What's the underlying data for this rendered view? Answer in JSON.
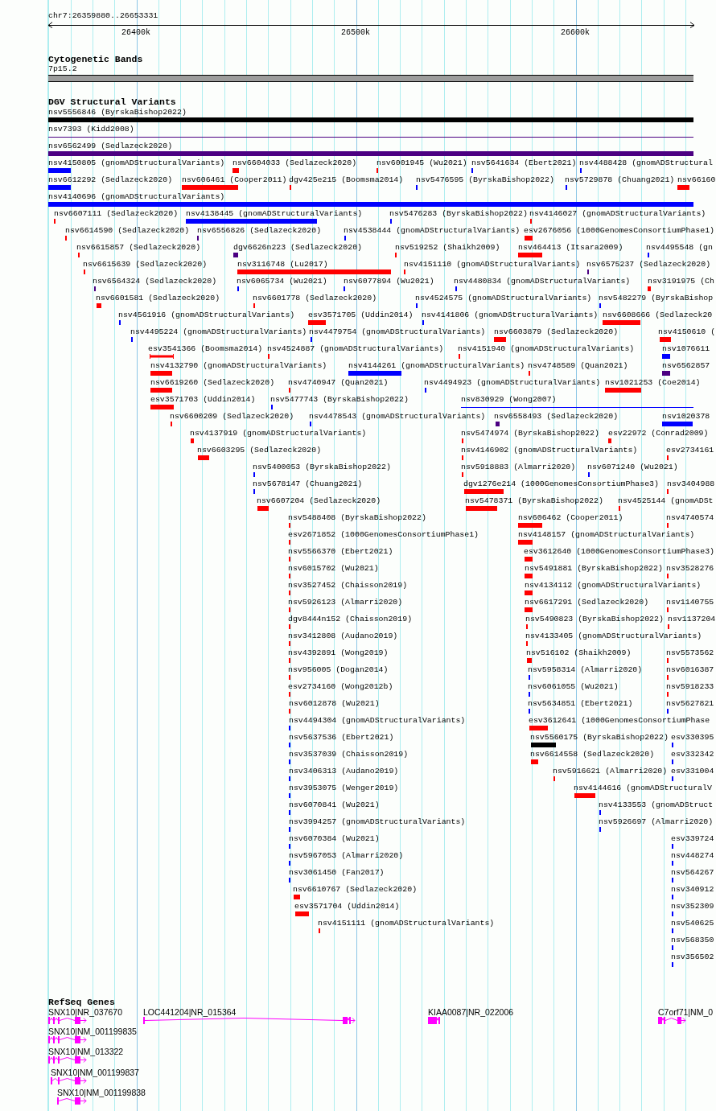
{
  "ruler": {
    "location": "chr7:26359880..26653331",
    "ticks": [
      "26400k",
      "26500k",
      "26600k"
    ]
  },
  "tracks": [
    {
      "title": "Cytogenetic Bands",
      "kind": "bands",
      "features": [
        {
          "label": "7p15.2"
        }
      ]
    },
    {
      "title": "DGV Structural Variants",
      "kind": "variants",
      "rows": [
        {
          "features": [
            {
              "label": "nsv5556846 (ByrskaBishop2022)",
              "color": "#000000",
              "kind": "bar"
            }
          ]
        },
        {
          "features": [
            {
              "label": "nsv7393 (Kidd2008)",
              "color": "#4b0082",
              "kind": "line"
            }
          ]
        },
        {
          "features": [
            {
              "label": "nsv6562499 (Sedlazeck2020)",
              "color": "#4b0082",
              "kind": "bar"
            }
          ]
        },
        {
          "features": [
            {
              "label": "nsv4150805 (gnomADStructuralVariants)",
              "color": "#0000ff",
              "kind": "bar"
            },
            {
              "label": "nsv6604033 (Sedlazeck2020)",
              "color": "#ff0000",
              "kind": "bar"
            },
            {
              "label": "nsv6001945 (Wu2021)",
              "color": "#ff0000",
              "kind": "bar"
            },
            {
              "label": "nsv5641634 (Ebert2021)",
              "color": "#0000ff",
              "kind": "bar"
            },
            {
              "label": "nsv4488428 (gnomADStructural",
              "color": "#0000ff",
              "kind": "bar"
            }
          ]
        },
        {
          "features": [
            {
              "label": "nsv6612292 (Sedlazeck2020)",
              "color": "#0000ff",
              "kind": "bar"
            },
            {
              "label": "nsv606461 (Cooper2011)",
              "color": "#ff0000",
              "kind": "bar"
            },
            {
              "label": "dgv425e215 (Boomsma2014)",
              "color": "#ff0000",
              "kind": "bar"
            },
            {
              "label": "nsv5476595 (ByrskaBishop2022)",
              "color": "#0000ff",
              "kind": "bar"
            },
            {
              "label": "nsv5729878 (Chuang2021)",
              "color": "#0000ff",
              "kind": "bar"
            },
            {
              "label": "nsv66160",
              "color": "#ff0000",
              "kind": "bar"
            }
          ]
        },
        {
          "features": [
            {
              "label": "nsv4140696 (gnomADStructuralVariants)",
              "color": "#0000ff",
              "kind": "bar"
            }
          ]
        },
        {
          "features": [
            {
              "label": "nsv6607111 (Sedlazeck2020)",
              "color": "#ff0000",
              "kind": "bar"
            },
            {
              "label": "nsv4138445 (gnomADStructuralVariants)",
              "color": "#0000ff",
              "kind": "bar"
            },
            {
              "label": "nsv5476283 (ByrskaBishop2022)",
              "color": "#0000ff",
              "kind": "bar"
            },
            {
              "label": "nsv4146027 (gnomADStructuralVariants)",
              "color": "#ff0000",
              "kind": "bar"
            }
          ]
        },
        {
          "features": [
            {
              "label": "nsv6614590 (Sedlazeck2020)",
              "color": "#ff0000",
              "kind": "bar"
            },
            {
              "label": "nsv6556826 (Sedlazeck2020)",
              "color": "#4b0082",
              "kind": "bar"
            },
            {
              "label": "nsv4538444 (gnomADStructuralVariants)",
              "color": "#0000ff",
              "kind": "bar"
            },
            {
              "label": "esv2676056 (1000GenomesConsortiumPhase1)",
              "color": "#ff0000",
              "kind": "bar"
            }
          ]
        },
        {
          "features": [
            {
              "label": "nsv6615857 (Sedlazeck2020)",
              "color": "#ff0000",
              "kind": "bar"
            },
            {
              "label": "dgv6626n223 (Sedlazeck2020)",
              "color": "#4b0082",
              "kind": "bar"
            },
            {
              "label": "nsv519252 (Shaikh2009)",
              "color": "#ff0000",
              "kind": "bar"
            },
            {
              "label": "nsv464413 (Itsara2009)",
              "color": "#ff0000",
              "kind": "bar"
            },
            {
              "label": "nsv4495548 (gn",
              "color": "#0000ff",
              "kind": "bar"
            }
          ]
        },
        {
          "features": [
            {
              "label": "nsv6615639 (Sedlazeck2020)",
              "color": "#ff0000",
              "kind": "bar"
            },
            {
              "label": "nsv3116748 (Lu2017)",
              "color": "#ff0000",
              "kind": "bar"
            },
            {
              "label": "nsv4151110 (gnomADStructuralVariants)",
              "color": "#ff0000",
              "kind": "bar"
            },
            {
              "label": "nsv6575237 (Sedlazeck2020)",
              "color": "#4b0082",
              "kind": "bar"
            }
          ]
        },
        {
          "features": [
            {
              "label": "nsv6564324 (Sedlazeck2020)",
              "color": "#4b0082",
              "kind": "bar"
            },
            {
              "label": "nsv6065734 (Wu2021)",
              "color": "#0000ff",
              "kind": "bar"
            },
            {
              "label": "nsv6077894 (Wu2021)",
              "color": "#0000ff",
              "kind": "bar"
            },
            {
              "label": "nsv4480834 (gnomADStructuralVariants)",
              "color": "#0000ff",
              "kind": "bar"
            },
            {
              "label": "nsv3191975 (Ch",
              "color": "#ff0000",
              "kind": "bar"
            }
          ]
        },
        {
          "features": [
            {
              "label": "nsv6601581 (Sedlazeck2020)",
              "color": "#ff0000",
              "kind": "bar"
            },
            {
              "label": "nsv6601778 (Sedlazeck2020)",
              "color": "#ff0000",
              "kind": "bar"
            },
            {
              "label": "nsv4524575 (gnomADStructuralVariants)",
              "color": "#0000ff",
              "kind": "bar"
            },
            {
              "label": "nsv5482279 (ByrskaBishop",
              "color": "#0000ff",
              "kind": "bar"
            }
          ]
        },
        {
          "features": [
            {
              "label": "nsv4561916 (gnomADStructuralVariants)",
              "color": "#0000ff",
              "kind": "bar"
            },
            {
              "label": "esv3571705 (Uddin2014)",
              "color": "#ff0000",
              "kind": "bar"
            },
            {
              "label": "nsv4141806 (gnomADStructuralVariants)",
              "color": "#0000ff",
              "kind": "bar"
            },
            {
              "label": "nsv6608666 (Sedlazeck20",
              "color": "#ff0000",
              "kind": "bar"
            }
          ]
        },
        {
          "features": [
            {
              "label": "nsv4495224 (gnomADStructuralVariants)",
              "color": "#0000ff",
              "kind": "bar"
            },
            {
              "label": "nsv4479754 (gnomADStructuralVariants)",
              "color": "#0000ff",
              "kind": "bar"
            },
            {
              "label": "nsv6603879 (Sedlazeck2020)",
              "color": "#ff0000",
              "kind": "bar"
            },
            {
              "label": "nsv4150610 (",
              "color": "#ff0000",
              "kind": "bar"
            }
          ]
        },
        {
          "features": [
            {
              "label": "esv3541366 (Boomsma2014)",
              "color": "#ff0000",
              "kind": "capped"
            },
            {
              "label": "nsv4524887 (gnomADStructuralVariants)",
              "color": "#ff0000",
              "kind": "bar"
            },
            {
              "label": "nsv4151940 (gnomADStructuralVariants)",
              "color": "#ff0000",
              "kind": "bar"
            },
            {
              "label": "nsv1076611",
              "color": "#0000ff",
              "kind": "bar"
            }
          ]
        },
        {
          "features": [
            {
              "label": "nsv4132790 (gnomADStructuralVariants)",
              "color": "#ff0000",
              "kind": "bar"
            },
            {
              "label": "nsv4144261 (gnomADStructuralVariants)",
              "color": "#0000ff",
              "kind": "bar"
            },
            {
              "label": "nsv4748589 (Quan2021)",
              "color": "#ff0000",
              "kind": "bar"
            },
            {
              "label": "nsv6562857",
              "color": "#4b0082",
              "kind": "bar"
            }
          ]
        },
        {
          "features": [
            {
              "label": "nsv6619260 (Sedlazeck2020)",
              "color": "#ff0000",
              "kind": "bar"
            },
            {
              "label": "nsv4740947 (Quan2021)",
              "color": "#ff0000",
              "kind": "bar"
            },
            {
              "label": "nsv4494923 (gnomADStructuralVariants)",
              "color": "#0000ff",
              "kind": "bar"
            },
            {
              "label": "nsv1021253 (Coe2014)",
              "color": "#ff0000",
              "kind": "bar"
            }
          ]
        },
        {
          "features": [
            {
              "label": "esv3571703 (Uddin2014)",
              "color": "#ff0000",
              "kind": "bar"
            },
            {
              "label": "nsv5477743 (ByrskaBishop2022)",
              "color": "#0000ff",
              "kind": "bar"
            },
            {
              "label": "nsv830929 (Wong2007)",
              "color": "#0000ff",
              "kind": "line"
            }
          ]
        },
        {
          "features": [
            {
              "label": "nsv6600209 (Sedlazeck2020)",
              "color": "#ff0000",
              "kind": "bar"
            },
            {
              "label": "nsv4478543 (gnomADStructuralVariants)",
              "color": "#0000ff",
              "kind": "bar"
            },
            {
              "label": "nsv6558493 (Sedlazeck2020)",
              "color": "#4b0082",
              "kind": "bar"
            },
            {
              "label": "nsv1020378",
              "color": "#0000ff",
              "kind": "bar"
            }
          ]
        },
        {
          "features": [
            {
              "label": "nsv4137919 (gnomADStructuralVariants)",
              "color": "#ff0000",
              "kind": "bar"
            },
            {
              "label": "nsv5474974 (ByrskaBishop2022)",
              "color": "#ff0000",
              "kind": "bar"
            },
            {
              "label": "esv22972 (Conrad2009)",
              "color": "#ff0000",
              "kind": "bar"
            }
          ]
        },
        {
          "features": [
            {
              "label": "nsv6603295 (Sedlazeck2020)",
              "color": "#ff0000",
              "kind": "bar"
            },
            {
              "label": "nsv4146902 (gnomADStructuralVariants)",
              "color": "#ff0000",
              "kind": "bar"
            },
            {
              "label": "esv2734161",
              "color": "#ff0000",
              "kind": "bar"
            }
          ]
        },
        {
          "features": [
            {
              "label": "nsv5400053 (ByrskaBishop2022)",
              "color": "#0000ff",
              "kind": "bar"
            },
            {
              "label": "nsv5918883 (Almarri2020)",
              "color": "#ff0000",
              "kind": "bar"
            },
            {
              "label": "nsv6071240 (Wu2021)",
              "color": "#0000ff",
              "kind": "bar"
            }
          ]
        },
        {
          "features": [
            {
              "label": "nsv5678147 (Chuang2021)",
              "color": "#0000ff",
              "kind": "bar"
            },
            {
              "label": "dgv1276e214 (1000GenomesConsortiumPhase3)",
              "color": "#ff0000",
              "kind": "bar"
            },
            {
              "label": "nsv3404988",
              "color": "#ff0000",
              "kind": "bar"
            }
          ]
        },
        {
          "features": [
            {
              "label": "nsv6607204 (Sedlazeck2020)",
              "color": "#ff0000",
              "kind": "bar"
            },
            {
              "label": "nsv5478371 (ByrskaBishop2022)",
              "color": "#ff0000",
              "kind": "bar"
            },
            {
              "label": "nsv4525144 (gnomADSt",
              "color": "#ff0000",
              "kind": "bar"
            }
          ]
        },
        {
          "features": [
            {
              "label": "nsv5488408 (ByrskaBishop2022)",
              "color": "#ff0000",
              "kind": "bar"
            },
            {
              "label": "nsv606462 (Cooper2011)",
              "color": "#ff0000",
              "kind": "bar"
            },
            {
              "label": "nsv4740574",
              "color": "#ff0000",
              "kind": "bar"
            }
          ]
        },
        {
          "features": [
            {
              "label": "esv2671852 (1000GenomesConsortiumPhase1)",
              "color": "#ff0000",
              "kind": "bar"
            },
            {
              "label": "nsv4148157 (gnomADStructuralVariants)",
              "color": "#ff0000",
              "kind": "bar"
            }
          ]
        },
        {
          "features": [
            {
              "label": "nsv5566370 (Ebert2021)",
              "color": "#ff0000",
              "kind": "bar"
            },
            {
              "label": "esv3612640 (1000GenomesConsortiumPhase3)",
              "color": "#ff0000",
              "kind": "bar"
            }
          ]
        },
        {
          "features": [
            {
              "label": "nsv6015702 (Wu2021)",
              "color": "#ff0000",
              "kind": "bar"
            },
            {
              "label": "nsv5491881 (ByrskaBishop2022)",
              "color": "#ff0000",
              "kind": "bar"
            },
            {
              "label": "nsv3528276",
              "color": "#ff0000",
              "kind": "bar"
            }
          ]
        },
        {
          "features": [
            {
              "label": "nsv3527452 (Chaisson2019)",
              "color": "#ff0000",
              "kind": "bar"
            },
            {
              "label": "nsv4134112 (gnomADStructuralVariants)",
              "color": "#ff0000",
              "kind": "bar"
            }
          ]
        },
        {
          "features": [
            {
              "label": "nsv5926123 (Almarri2020)",
              "color": "#ff0000",
              "kind": "bar"
            },
            {
              "label": "nsv6617291 (Sedlazeck2020)",
              "color": "#ff0000",
              "kind": "bar"
            },
            {
              "label": "nsv1140755",
              "color": "#ff0000",
              "kind": "bar"
            }
          ]
        },
        {
          "features": [
            {
              "label": "dgv8444n152 (Chaisson2019)",
              "color": "#ff0000",
              "kind": "bar"
            },
            {
              "label": "nsv5490823 (ByrskaBishop2022)",
              "color": "#ff0000",
              "kind": "bar"
            },
            {
              "label": "nsv1137204",
              "color": "#ff0000",
              "kind": "bar"
            }
          ]
        },
        {
          "features": [
            {
              "label": "nsv3412808 (Audano2019)",
              "color": "#ff0000",
              "kind": "bar"
            },
            {
              "label": "nsv4133405 (gnomADStructuralVariants)",
              "color": "#ff0000",
              "kind": "bar"
            }
          ]
        },
        {
          "features": [
            {
              "label": "nsv4392891 (Wong2019)",
              "color": "#ff0000",
              "kind": "bar"
            },
            {
              "label": "nsv516102 (Shaikh2009)",
              "color": "#ff0000",
              "kind": "bar"
            },
            {
              "label": "nsv5573562",
              "color": "#ff0000",
              "kind": "bar"
            }
          ]
        },
        {
          "features": [
            {
              "label": "nsv956005 (Dogan2014)",
              "color": "#ff0000",
              "kind": "bar"
            },
            {
              "label": "nsv5958314 (Almarri2020)",
              "color": "#0000ff",
              "kind": "bar"
            },
            {
              "label": "nsv6016387",
              "color": "#ff0000",
              "kind": "bar"
            }
          ]
        },
        {
          "features": [
            {
              "label": "esv2734160 (Wong2012b)",
              "color": "#ff0000",
              "kind": "bar"
            },
            {
              "label": "nsv6061055 (Wu2021)",
              "color": "#0000ff",
              "kind": "bar"
            },
            {
              "label": "nsv5918233",
              "color": "#ff0000",
              "kind": "bar"
            }
          ]
        },
        {
          "features": [
            {
              "label": "nsv6012878 (Wu2021)",
              "color": "#ff0000",
              "kind": "bar"
            },
            {
              "label": "nsv5634851 (Ebert2021)",
              "color": "#0000ff",
              "kind": "bar"
            },
            {
              "label": "nsv5627821",
              "color": "#0000ff",
              "kind": "bar"
            }
          ]
        },
        {
          "features": [
            {
              "label": "nsv4494304 (gnomADStructuralVariants)",
              "color": "#0000ff",
              "kind": "bar"
            },
            {
              "label": "esv3612641 (1000GenomesConsortiumPhase",
              "color": "#ff0000",
              "kind": "bar"
            }
          ]
        },
        {
          "features": [
            {
              "label": "nsv5637536 (Ebert2021)",
              "color": "#0000ff",
              "kind": "bar"
            },
            {
              "label": "nsv5560175 (ByrskaBishop2022)",
              "color": "#000000",
              "kind": "bar"
            },
            {
              "label": "esv330395",
              "color": "#0000ff",
              "kind": "bar"
            }
          ]
        },
        {
          "features": [
            {
              "label": "nsv3537039 (Chaisson2019)",
              "color": "#0000ff",
              "kind": "bar"
            },
            {
              "label": "nsv6614558 (Sedlazeck2020)",
              "color": "#ff0000",
              "kind": "bar"
            },
            {
              "label": "esv332342",
              "color": "#0000ff",
              "kind": "bar"
            }
          ]
        },
        {
          "features": [
            {
              "label": "nsv3406313 (Audano2019)",
              "color": "#0000ff",
              "kind": "bar"
            },
            {
              "label": "nsv5916621 (Almarri2020)",
              "color": "#ff0000",
              "kind": "bar"
            },
            {
              "label": "esv331004",
              "color": "#0000ff",
              "kind": "bar"
            }
          ]
        },
        {
          "features": [
            {
              "label": "nsv3953075 (Wenger2019)",
              "color": "#0000ff",
              "kind": "bar"
            },
            {
              "label": "nsv4144616 (gnomADStructuralV",
              "color": "#ff0000",
              "kind": "bar"
            }
          ]
        },
        {
          "features": [
            {
              "label": "nsv6070841 (Wu2021)",
              "color": "#0000ff",
              "kind": "bar"
            },
            {
              "label": "nsv4133553 (gnomADStruct",
              "color": "#0000ff",
              "kind": "bar"
            }
          ]
        },
        {
          "features": [
            {
              "label": "nsv3994257 (gnomADStructuralVariants)",
              "color": "#0000ff",
              "kind": "bar"
            },
            {
              "label": "nsv5926697 (Almarri2020)",
              "color": "#0000ff",
              "kind": "bar"
            }
          ]
        },
        {
          "features": [
            {
              "label": "nsv6070384 (Wu2021)",
              "color": "#0000ff",
              "kind": "bar"
            },
            {
              "label": "esv339724",
              "color": "#0000ff",
              "kind": "bar"
            }
          ]
        },
        {
          "features": [
            {
              "label": "nsv5967053 (Almarri2020)",
              "color": "#0000ff",
              "kind": "bar"
            },
            {
              "label": "nsv448274",
              "color": "#0000ff",
              "kind": "bar"
            }
          ]
        },
        {
          "features": [
            {
              "label": "nsv3061450 (Fan2017)",
              "color": "#0000ff",
              "kind": "bar"
            },
            {
              "label": "nsv564267",
              "color": "#0000ff",
              "kind": "bar"
            }
          ]
        },
        {
          "features": [
            {
              "label": "nsv6610767 (Sedlazeck2020)",
              "color": "#ff0000",
              "kind": "bar"
            },
            {
              "label": "nsv340912",
              "color": "#0000ff",
              "kind": "bar"
            }
          ]
        },
        {
          "features": [
            {
              "label": "esv3571704 (Uddin2014)",
              "color": "#ff0000",
              "kind": "bar"
            },
            {
              "label": "nsv352309",
              "color": "#0000ff",
              "kind": "bar"
            }
          ]
        },
        {
          "features": [
            {
              "label": "nsv4151111 (gnomADStructuralVariants)",
              "color": "#ff0000",
              "kind": "bar"
            },
            {
              "label": "nsv540625",
              "color": "#0000ff",
              "kind": "bar"
            }
          ]
        },
        {
          "features": [
            {
              "label": "nsv568350",
              "color": "#0000ff",
              "kind": "bar"
            }
          ]
        },
        {
          "features": [
            {
              "label": "nsv356502",
              "color": "#0000ff",
              "kind": "bar"
            }
          ]
        }
      ]
    },
    {
      "title": "RefSeq Genes",
      "kind": "genes",
      "features": [
        {
          "label": "SNX10|NR_037670"
        },
        {
          "label": "LOC441204|NR_015364"
        },
        {
          "label": "KIAA0087|NR_022006"
        },
        {
          "label": "C7orf71|NM_0"
        },
        {
          "label": "SNX10|NM_001199835"
        },
        {
          "label": "SNX10|NM_013322"
        },
        {
          "label": "SNX10|NM_001199837"
        },
        {
          "label": "SNX10|NM_001199838"
        }
      ]
    }
  ]
}
